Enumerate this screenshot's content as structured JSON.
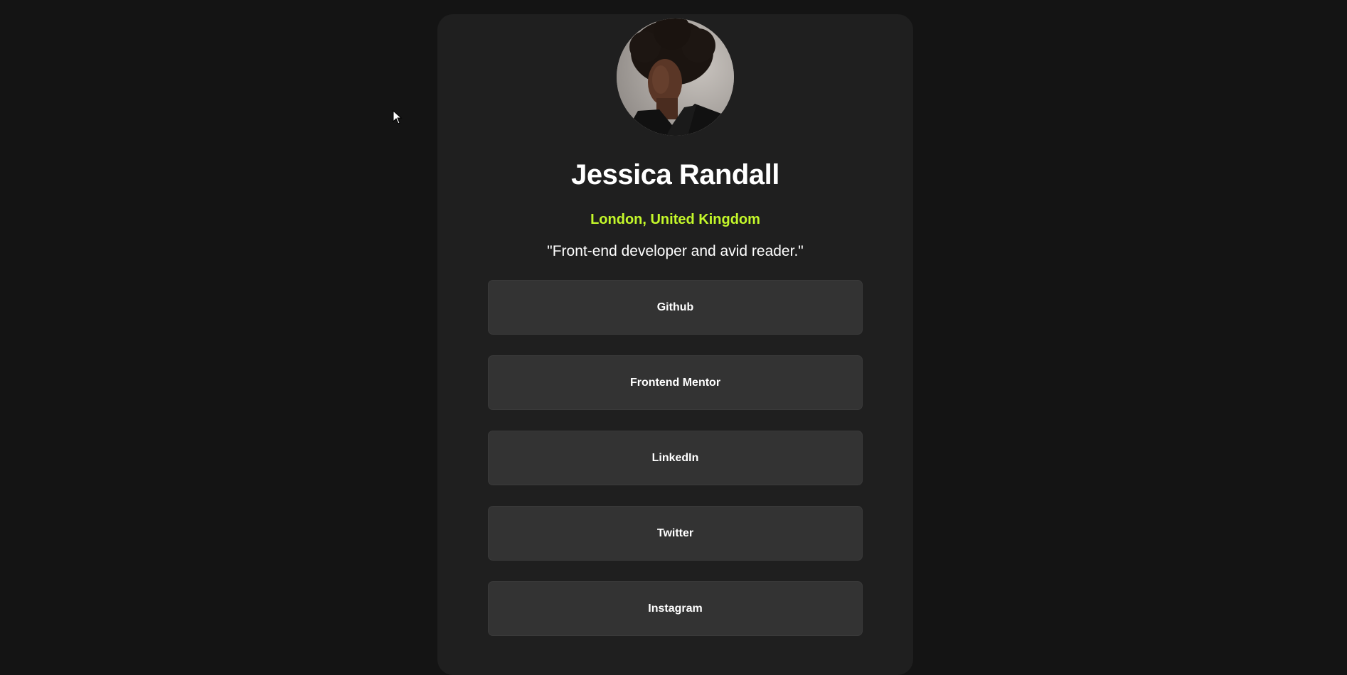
{
  "profile": {
    "name": "Jessica Randall",
    "location": "London, United Kingdom",
    "bio": "\"Front-end developer and avid reader.\"",
    "avatar_icon": "profile-photo",
    "accent_color": "#c4f82a"
  },
  "links": [
    {
      "label": "Github"
    },
    {
      "label": "Frontend Mentor"
    },
    {
      "label": "LinkedIn"
    },
    {
      "label": "Twitter"
    },
    {
      "label": "Instagram"
    }
  ],
  "colors": {
    "background": "#141414",
    "card": "#1f1f1f",
    "button": "#333333",
    "text": "#ffffff"
  }
}
